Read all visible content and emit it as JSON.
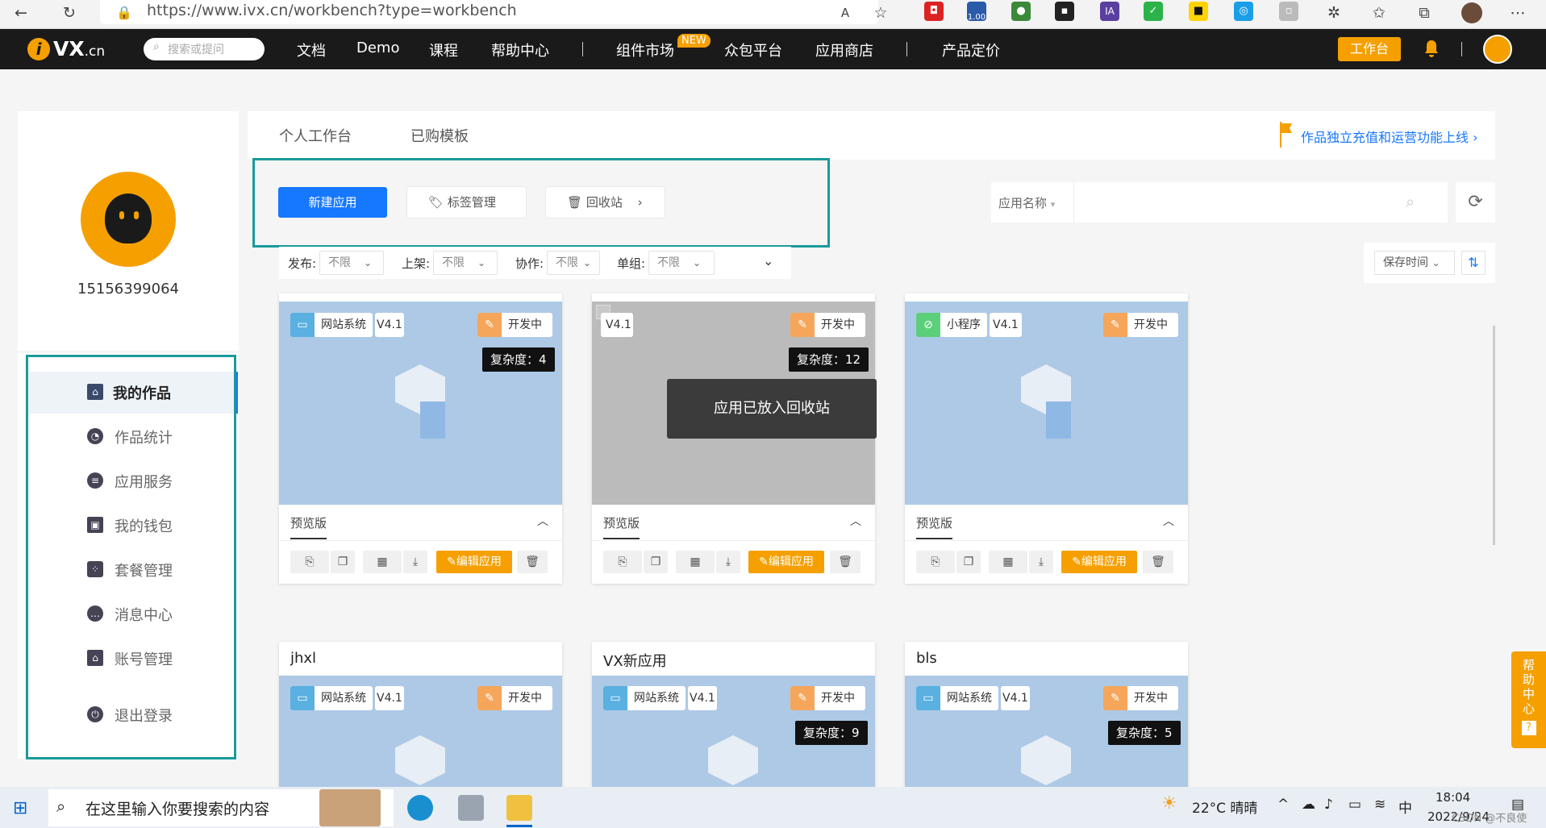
{
  "browser": {
    "url": "https://www.ivx.cn/workbench?type=workbench",
    "ext_badge": "1.00"
  },
  "nav": {
    "logo_main": "VX",
    "logo_suffix": ".cn",
    "search_placeholder": "搜索或提问",
    "items": [
      "文档",
      "Demo",
      "课程",
      "帮助中心",
      "组件市场",
      "众包平台",
      "应用商店",
      "产品定价"
    ],
    "new_badge": "NEW",
    "workbench": "工作台"
  },
  "profile": {
    "username": "15156399064"
  },
  "sidebar": {
    "items": [
      {
        "label": "我的作品",
        "icon": "home-icon"
      },
      {
        "label": "作品统计",
        "icon": "pie-chart-icon"
      },
      {
        "label": "应用服务",
        "icon": "service-icon"
      },
      {
        "label": "我的钱包",
        "icon": "wallet-icon"
      },
      {
        "label": "套餐管理",
        "icon": "package-icon"
      },
      {
        "label": "消息中心",
        "icon": "message-icon"
      },
      {
        "label": "账号管理",
        "icon": "account-icon"
      },
      {
        "label": "退出登录",
        "icon": "power-icon"
      }
    ]
  },
  "tabs": [
    "个人工作台",
    "已购模板"
  ],
  "notice": "作品独立充值和运营功能上线",
  "actions": {
    "new_app": "新建应用",
    "tag_manage": "标签管理",
    "recycle": "回收站"
  },
  "search": {
    "select": "应用名称",
    "placeholder": ""
  },
  "filters": [
    {
      "label": "发布:",
      "value": "不限"
    },
    {
      "label": "上架:",
      "value": "不限"
    },
    {
      "label": "协作:",
      "value": "不限"
    },
    {
      "label": "单组:",
      "value": "不限"
    }
  ],
  "sort": {
    "label": "保存时间"
  },
  "cards_row1": [
    {
      "type": "网站系统",
      "version": "V4.1",
      "status": "开发中",
      "complexity": "复杂度：4",
      "preview": "预览版",
      "edit": "编辑应用"
    },
    {
      "type": "",
      "version": "V4.1",
      "status": "开发中",
      "complexity": "复杂度：12",
      "preview": "预览版",
      "edit": "编辑应用"
    },
    {
      "type": "小程序",
      "version": "V4.1",
      "status": "开发中",
      "complexity": "",
      "preview": "预览版",
      "edit": "编辑应用"
    }
  ],
  "cards_row2": [
    {
      "title": "jhxl",
      "type": "网站系统",
      "version": "V4.1",
      "status": "开发中",
      "complexity": ""
    },
    {
      "title": "VX新应用",
      "type": "网站系统",
      "version": "V4.1",
      "status": "开发中",
      "complexity": "复杂度：9"
    },
    {
      "title": "bls",
      "type": "网站系统",
      "version": "V4.1",
      "status": "开发中",
      "complexity": "复杂度：5"
    }
  ],
  "toast": "应用已放入回收站",
  "help_tab": "帮助中心",
  "help_q": "?",
  "taskbar": {
    "search_text": "在这里输入你要搜索的内容",
    "weather": "22°C 晴晴",
    "ime": "中",
    "time": "18:04",
    "date": "2022/9/24",
    "watermark": "CSDN @不良使"
  },
  "colors": {
    "brand": "#f5a000",
    "primary": "#1677ff",
    "highlight": "#1a9a9a"
  }
}
